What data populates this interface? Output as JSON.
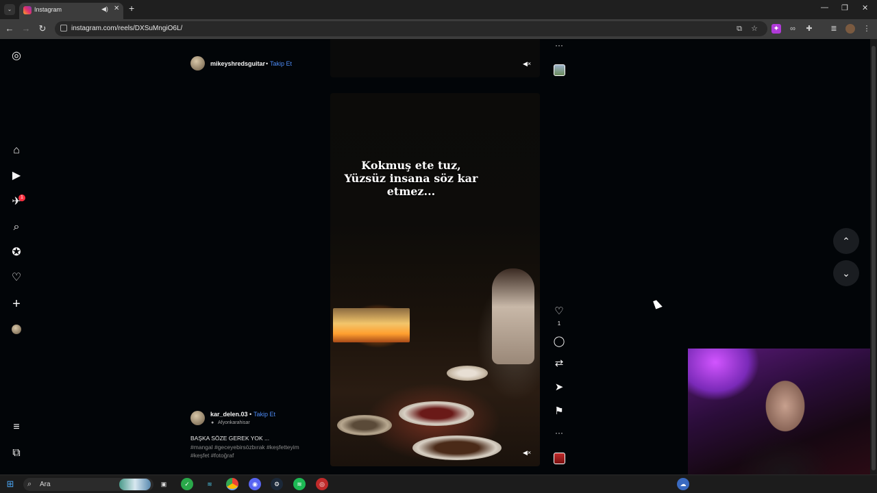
{
  "browser": {
    "tab_title": "Instagram",
    "url": "instagram.com/reels/DXSuMngiO6L/",
    "new_tab_symbol": "+",
    "close_tab_symbol": "✕",
    "minimize_symbol": "—",
    "restore_symbol": "❐",
    "close_window_symbol": "✕",
    "tab_menu_symbol": "⌄",
    "back_symbol": "←",
    "forward_symbol": "→",
    "reload_symbol": "↻"
  },
  "sidebar": {
    "notification_count": "1",
    "items": [
      {
        "name": "instagram-logo-icon",
        "symbol": "◎"
      },
      {
        "name": "home-icon",
        "symbol": "⌂"
      },
      {
        "name": "reels-icon",
        "symbol": "▶"
      },
      {
        "name": "messages-icon",
        "symbol": "✈"
      },
      {
        "name": "search-icon",
        "symbol": "⌕"
      },
      {
        "name": "explore-icon",
        "symbol": "✪"
      },
      {
        "name": "notifications-icon",
        "symbol": "♡"
      },
      {
        "name": "create-icon",
        "symbol": "+"
      },
      {
        "name": "more-icon",
        "symbol": "≡"
      },
      {
        "name": "meta-icon",
        "symbol": "⧉"
      }
    ]
  },
  "reels": {
    "previous": {
      "username": "mikeyshredsguitar",
      "separator": "•",
      "follow_label": "Takip Et"
    },
    "current": {
      "username": "kar_delen.03",
      "separator": "•",
      "follow_label": "Takip Et",
      "location": "Afyonkarahisar",
      "caption": "BAŞKA SÖZE GEREK YOK ...",
      "hashtags": "#mangal #geceyebirsözbırak #keşfetteyim #keşfet #fotoğraf",
      "overlay_text_line1": "Kokmuş ete tuz,",
      "overlay_text_line2": "Yüzsüz insana söz kar",
      "overlay_text_line3": "etmez...",
      "like_count": "1"
    }
  },
  "actions": {
    "more_symbol": "···",
    "like_symbol": "♡",
    "comment_symbol": "◯",
    "repost_symbol": "⇄",
    "share_symbol": "➤",
    "save_symbol": "⚑",
    "mute_symbol": "🔇",
    "nav_up_symbol": "⌃",
    "nav_down_symbol": "⌄"
  },
  "taskbar": {
    "search_placeholder": "Ara",
    "start_symbol": "⊞",
    "search_symbol": "⌕"
  },
  "colors": {
    "follow_blue": "#4d8bf5",
    "badge_red": "#ff3040",
    "page_bg": "#020508"
  }
}
